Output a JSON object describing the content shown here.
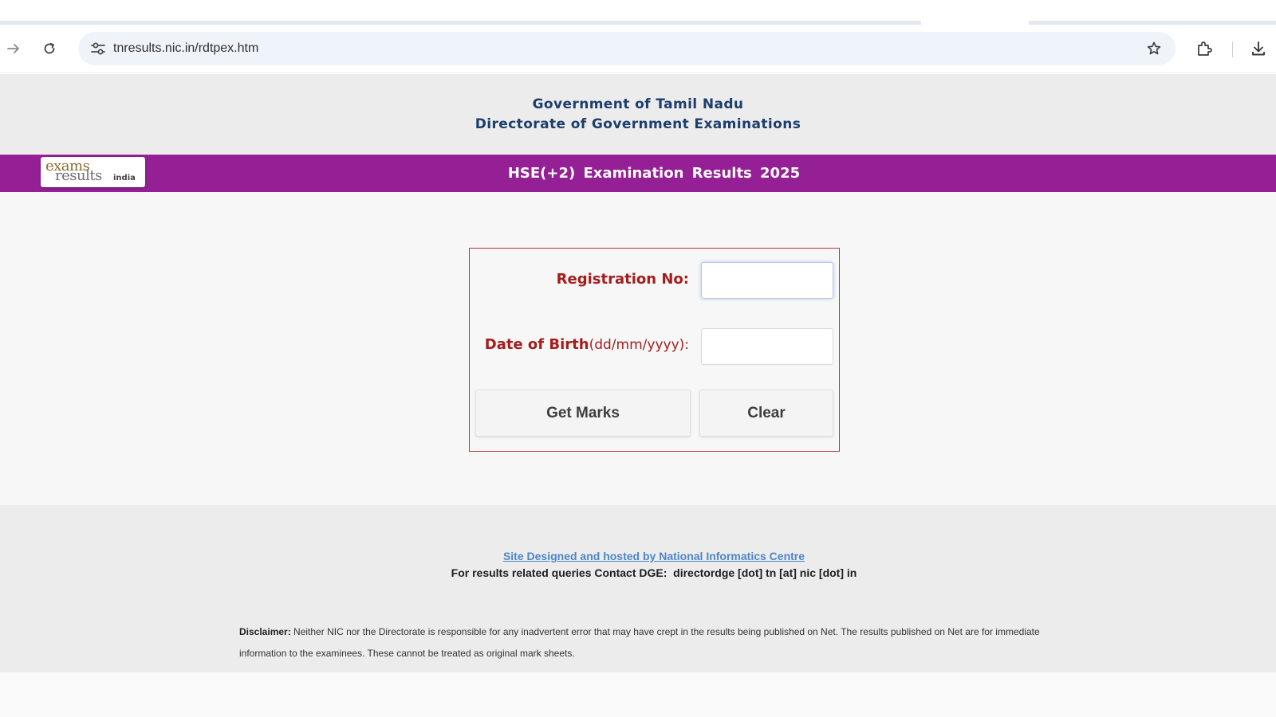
{
  "browser": {
    "url": "tnresults.nic.in/rdtpex.htm"
  },
  "header": {
    "line1": "Government of Tamil Nadu",
    "line2": "Directorate of Government Examinations"
  },
  "banner": {
    "title": "HSE(+2)  Examination Results  2025",
    "logo_word1": "exams",
    "logo_word2": "results",
    "logo_word3": "india"
  },
  "form": {
    "registration_label": "Registration No:",
    "registration_value": "",
    "dob_label": "Date of Birth",
    "dob_hint": "(dd/mm/yyyy):",
    "dob_value": "",
    "get_marks_label": "Get Marks",
    "clear_label": "Clear"
  },
  "footer": {
    "credit_link": "Site Designed and hosted by National Informatics Centre",
    "contact": "For results related queries Contact DGE:  directordge [dot] tn [at] nic [dot] in",
    "disclaimer_label": "Disclaimer:",
    "disclaimer_text": "Neither NIC nor the Directorate is responsible for any inadvertent error that may have crept in the results being published on Net. The results published on Net are for immediate information to the examinees. These cannot be treated as original mark sheets."
  },
  "colors": {
    "banner_purple": "#951f94",
    "label_red": "#a61c1c",
    "header_navy": "#1d3d6e",
    "link_blue": "#4d86c7"
  },
  "icons": [
    "forward-icon",
    "reload-icon",
    "site-settings-icon",
    "bookmark-star-icon",
    "extensions-icon",
    "download-icon"
  ]
}
